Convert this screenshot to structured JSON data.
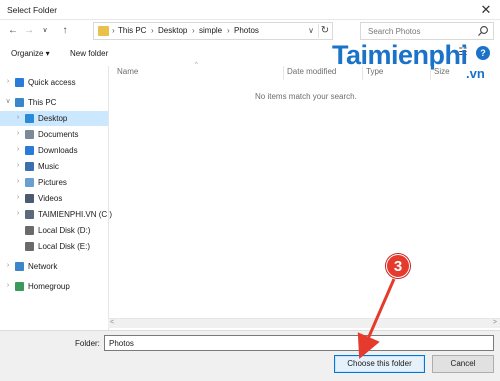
{
  "window": {
    "title": "Select Folder",
    "close_glyph": "✕"
  },
  "nav": {
    "back_glyph": "←",
    "forward_glyph": "→",
    "recent_glyph": "∨",
    "up_glyph": "↑"
  },
  "address": {
    "crumbs": [
      "This PC",
      "Desktop",
      "simple",
      "Photos"
    ],
    "separator": "›",
    "dropdown_glyph": "∨",
    "refresh_glyph": "↻"
  },
  "search": {
    "placeholder": "Search Photos"
  },
  "toolbar": {
    "organize_label": "Organize ▾",
    "new_folder_label": "New folder",
    "view_glyph": "☷",
    "help_glyph": "?"
  },
  "watermark": {
    "main": "Taimienphi",
    "suffix": ".vn",
    "color": "#1a73c9"
  },
  "sidebar": {
    "items": [
      {
        "label": "Quick access",
        "icon": "star-icon",
        "color": "#2a7bd8"
      },
      {
        "label": "This PC",
        "icon": "computer-icon",
        "color": "#3a86c8"
      },
      {
        "label": "Desktop",
        "icon": "desktop-folder-icon",
        "color": "#2a8ad8"
      },
      {
        "label": "Documents",
        "icon": "documents-icon",
        "color": "#7a8a99"
      },
      {
        "label": "Downloads",
        "icon": "downloads-icon",
        "color": "#2a7bd8"
      },
      {
        "label": "Music",
        "icon": "music-icon",
        "color": "#3a6fb0"
      },
      {
        "label": "Pictures",
        "icon": "pictures-icon",
        "color": "#6a9fd0"
      },
      {
        "label": "Videos",
        "icon": "videos-icon",
        "color": "#4a5a70"
      },
      {
        "label": "TAIMIENPHI.VN (C:)",
        "icon": "drive-c-icon",
        "color": "#5a6a7a"
      },
      {
        "label": "Local Disk (D:)",
        "icon": "drive-icon",
        "color": "#6a6a6a"
      },
      {
        "label": "Local Disk (E:)",
        "icon": "drive-icon",
        "color": "#6a6a6a"
      },
      {
        "label": "Network",
        "icon": "network-icon",
        "color": "#3a86c8"
      },
      {
        "label": "Homegroup",
        "icon": "homegroup-icon",
        "color": "#3a9a5a"
      }
    ],
    "selected_index": 2,
    "expand_glyph": "›",
    "expanded_glyph": "∨"
  },
  "list": {
    "columns": [
      "Name",
      "Date modified",
      "Type",
      "Size"
    ],
    "sort_glyph": "^",
    "empty_message": "No items match your search."
  },
  "scroll": {
    "left_glyph": "<",
    "right_glyph": ">"
  },
  "footer": {
    "folder_label": "Folder:",
    "folder_value": "Photos",
    "choose_label": "Choose this folder",
    "cancel_label": "Cancel"
  },
  "annotation": {
    "step": "3",
    "color": "#e53a2c"
  }
}
